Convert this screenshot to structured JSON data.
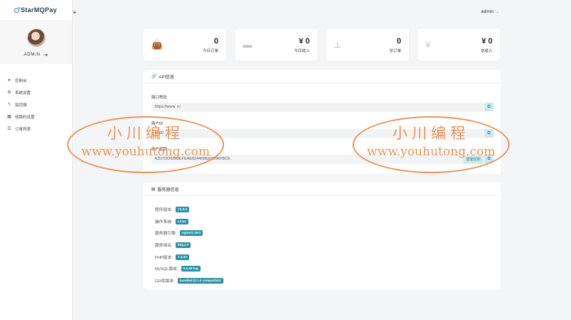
{
  "brand": {
    "name": "StarMQPay"
  },
  "user": {
    "name": "ADMIN"
  },
  "topbar": {
    "menu_icon": "≡",
    "admin_label": "admin"
  },
  "nav": {
    "items": [
      {
        "label": "控制台",
        "icon": "rocket-icon"
      },
      {
        "label": "系统设置",
        "icon": "gear-icon"
      },
      {
        "label": "监控端",
        "icon": "bolt-icon"
      },
      {
        "label": "收款码设置",
        "icon": "qrcode-icon"
      },
      {
        "label": "订单列表",
        "icon": "list-icon"
      }
    ]
  },
  "stats": [
    {
      "value": "0",
      "label": "今日订单",
      "icon": "bag-icon"
    },
    {
      "value": "¥ 0",
      "label": "今日收入",
      "icon": "wallet-icon"
    },
    {
      "value": "0",
      "label": "总订单",
      "icon": "chart-icon"
    },
    {
      "value": "¥ 0",
      "label": "总收入",
      "icon": "yen-icon"
    }
  ],
  "api": {
    "title": "API信息",
    "url_label": "接口地址",
    "url_value": "https://www.                    n/",
    "merchant_label": "商户ID",
    "merchant_value": "1000",
    "key_label": "商户密钥",
    "key_value": "62D7DD925BEFEAE8244D8E87D96FBCE",
    "reset_label": "重置密钥"
  },
  "server": {
    "title": "服务器信息",
    "rows": [
      {
        "label": "程序版本:",
        "value": "V1.0.0"
      },
      {
        "label": "操作系统:",
        "value": "Linux"
      },
      {
        "label": "服务器引擎:",
        "value": "nginx/1.18.0"
      },
      {
        "label": "服务域名:",
        "value": "https://"
      },
      {
        "label": "PHP版本:",
        "value": "7.4.30"
      },
      {
        "label": "MySQL版本:",
        "value": "5.6.50-log"
      },
      {
        "label": "GD库版本:",
        "value": "bundled (2.1.0 compatible)"
      }
    ]
  },
  "watermark": {
    "cn": "小川编程",
    "en": "www.youhutong.com"
  },
  "colors": {
    "accent": "#2d8fa6",
    "watermark": "#e7945a",
    "nav_active": "#2563c7"
  }
}
